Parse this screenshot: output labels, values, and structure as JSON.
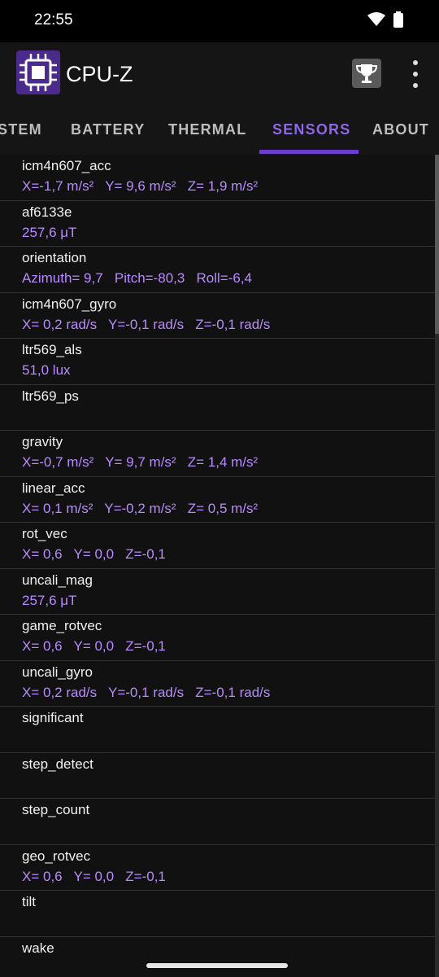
{
  "status": {
    "time": "22:55"
  },
  "app": {
    "title": "CPU-Z"
  },
  "tabs": [
    "STEM",
    "BATTERY",
    "THERMAL",
    "SENSORS",
    "ABOUT"
  ],
  "active_tab": "SENSORS",
  "sensors": [
    {
      "name": "icm4n607_acc",
      "value": "X=-1,7 m/s²   Y= 9,6 m/s²   Z= 1,9 m/s²"
    },
    {
      "name": "af6133e",
      "value": "257,6 μT"
    },
    {
      "name": "orientation",
      "value": "Azimuth= 9,7   Pitch=-80,3   Roll=-6,4"
    },
    {
      "name": "icm4n607_gyro",
      "value": "X= 0,2 rad/s   Y=-0,1 rad/s   Z=-0,1 rad/s"
    },
    {
      "name": "ltr569_als",
      "value": "51,0 lux"
    },
    {
      "name": "ltr569_ps",
      "value": ""
    },
    {
      "name": "gravity",
      "value": "X=-0,7 m/s²   Y= 9,7 m/s²   Z= 1,4 m/s²"
    },
    {
      "name": "linear_acc",
      "value": "X= 0,1 m/s²   Y=-0,2 m/s²   Z= 0,5 m/s²"
    },
    {
      "name": "rot_vec",
      "value": "X= 0,6   Y= 0,0   Z=-0,1"
    },
    {
      "name": "uncali_mag",
      "value": "257,6 μT"
    },
    {
      "name": "game_rotvec",
      "value": "X= 0,6   Y= 0,0   Z=-0,1"
    },
    {
      "name": "uncali_gyro",
      "value": "X= 0,2 rad/s   Y=-0,1 rad/s   Z=-0,1 rad/s"
    },
    {
      "name": "significant",
      "value": ""
    },
    {
      "name": "step_detect",
      "value": ""
    },
    {
      "name": "step_count",
      "value": ""
    },
    {
      "name": "geo_rotvec",
      "value": "X= 0,6   Y= 0,0   Z=-0,1"
    },
    {
      "name": "tilt",
      "value": ""
    },
    {
      "name": "wake",
      "value": ""
    }
  ]
}
